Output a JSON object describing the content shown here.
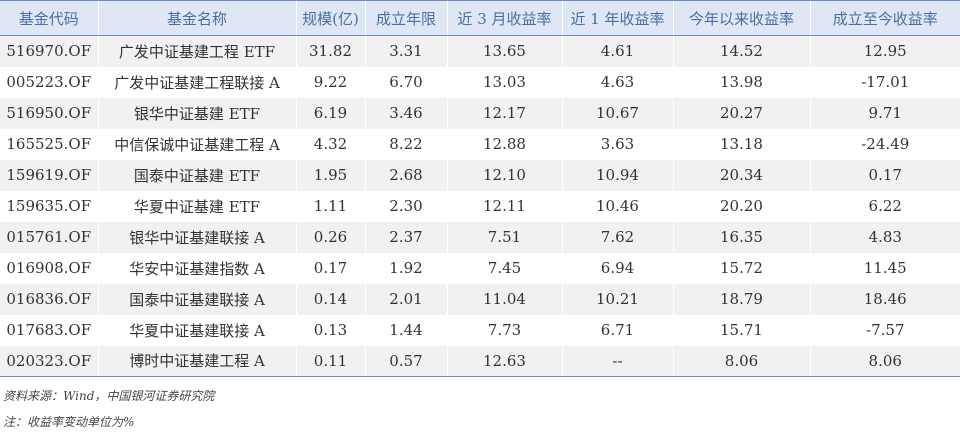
{
  "table": {
    "headers": [
      "基金代码",
      "基金名称",
      "规模(亿)",
      "成立年限",
      "近 3 月收益率",
      "近 1 年收益率",
      "今年以来收益率",
      "成立至今收益率"
    ],
    "rows": [
      [
        "516970.OF",
        "广发中证基建工程 ETF",
        "31.82",
        "3.31",
        "13.65",
        "4.61",
        "14.52",
        "12.95"
      ],
      [
        "005223.OF",
        "广发中证基建工程联接 A",
        "9.22",
        "6.70",
        "13.03",
        "4.63",
        "13.98",
        "-17.01"
      ],
      [
        "516950.OF",
        "银华中证基建 ETF",
        "6.19",
        "3.46",
        "12.17",
        "10.67",
        "20.27",
        "9.71"
      ],
      [
        "165525.OF",
        "中信保诚中证基建工程 A",
        "4.32",
        "8.22",
        "12.88",
        "3.63",
        "13.18",
        "-24.49"
      ],
      [
        "159619.OF",
        "国泰中证基建 ETF",
        "1.95",
        "2.68",
        "12.10",
        "10.94",
        "20.34",
        "0.17"
      ],
      [
        "159635.OF",
        "华夏中证基建 ETF",
        "1.11",
        "2.30",
        "12.11",
        "10.46",
        "20.20",
        "6.22"
      ],
      [
        "015761.OF",
        "银华中证基建联接 A",
        "0.26",
        "2.37",
        "7.51",
        "7.62",
        "16.35",
        "4.83"
      ],
      [
        "016908.OF",
        "华安中证基建指数 A",
        "0.17",
        "1.92",
        "7.45",
        "6.94",
        "15.72",
        "11.45"
      ],
      [
        "016836.OF",
        "国泰中证基建联接 A",
        "0.14",
        "2.01",
        "11.04",
        "10.21",
        "18.79",
        "18.46"
      ],
      [
        "017683.OF",
        "华夏中证基建联接 A",
        "0.13",
        "1.44",
        "7.73",
        "6.71",
        "15.71",
        "-7.57"
      ],
      [
        "020323.OF",
        "博时中证基建工程 A",
        "0.11",
        "0.57",
        "12.63",
        "--",
        "8.06",
        "8.06"
      ]
    ]
  },
  "source": "资料来源：Wind，中国银河证券研究院",
  "note": "注：收益率变动单位为%",
  "colors": {
    "header_bg": "#dfe6f4",
    "header_text": "#4a6fa5",
    "rule": "#6d8bbf",
    "stripe": "#f1f1f1"
  }
}
